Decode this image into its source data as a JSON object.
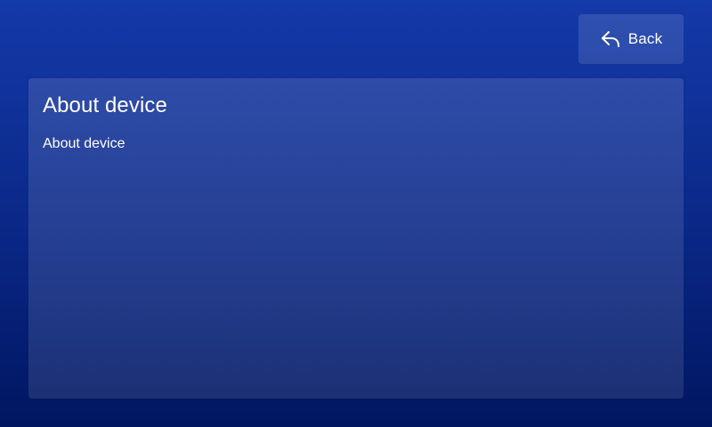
{
  "header": {
    "back_label": "Back",
    "back_icon": "reply-arrow-icon"
  },
  "panel": {
    "title": "About device",
    "body": "About device"
  }
}
